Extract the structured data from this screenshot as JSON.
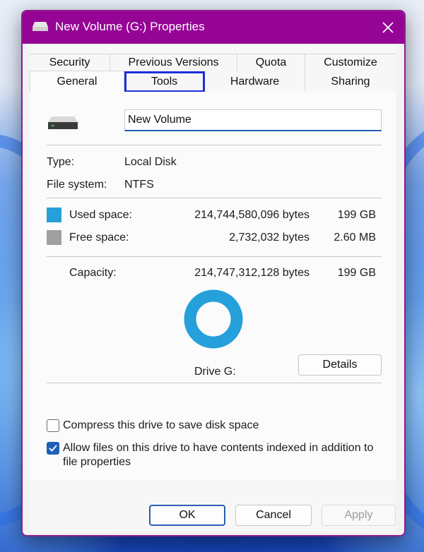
{
  "window": {
    "title": "New Volume (G:) Properties"
  },
  "tabs": {
    "row1": [
      "Security",
      "Previous Versions",
      "Quota",
      "Customize"
    ],
    "row2": [
      "General",
      "Tools",
      "Hardware",
      "Sharing"
    ],
    "active": "General",
    "focused": "Tools"
  },
  "general": {
    "volume_name": "New Volume",
    "type_label": "Type:",
    "type_value": "Local Disk",
    "fs_label": "File system:",
    "fs_value": "NTFS",
    "used_label": "Used space:",
    "used_bytes": "214,744,580,096 bytes",
    "used_size": "199 GB",
    "free_label": "Free space:",
    "free_bytes": "2,732,032 bytes",
    "free_size": "2.60 MB",
    "capacity_label": "Capacity:",
    "capacity_bytes": "214,747,312,128 bytes",
    "capacity_size": "199 GB",
    "drive_label": "Drive G:",
    "details_button": "Details",
    "compress_label": "Compress this drive to save disk space",
    "compress_checked": false,
    "index_label_line1": "Allow files on this drive to have contents indexed in addition to",
    "index_label_line2": "file properties",
    "index_checked": true,
    "used_fraction": 0.99999
  },
  "colors": {
    "titlebar": "#950495",
    "used": "#26a0da",
    "free": "#a0a0a0",
    "focus": "#1d2fd8"
  },
  "buttons": {
    "ok": "OK",
    "cancel": "Cancel",
    "apply": "Apply"
  }
}
